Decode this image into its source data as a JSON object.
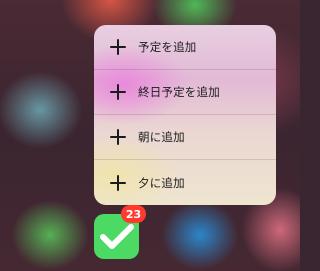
{
  "quick_actions": {
    "items": [
      {
        "label": "予定を追加",
        "icon": "plus-icon"
      },
      {
        "label": "終日予定を追加",
        "icon": "plus-icon"
      },
      {
        "label": "朝に追加",
        "icon": "plus-icon"
      },
      {
        "label": "夕に追加",
        "icon": "plus-icon"
      }
    ]
  },
  "app": {
    "icon": "checkmark-icon",
    "badge_count": "23",
    "icon_color": "#4cd964",
    "badge_color": "#ff3b30"
  }
}
